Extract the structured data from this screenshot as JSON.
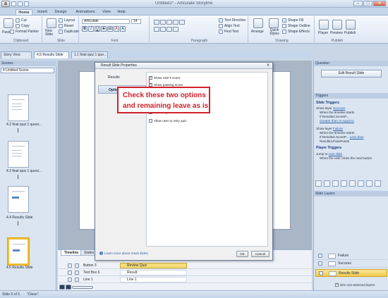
{
  "app": {
    "title": "Untitled1* - Articulate Storyline",
    "icon_letter": "a",
    "window_controls": [
      "–",
      "□",
      "✕"
    ]
  },
  "ribbon_tabs": [
    "Home",
    "Insert",
    "Design",
    "Animations",
    "View",
    "Help"
  ],
  "ribbon": {
    "clipboard": {
      "paste": "Paste",
      "cut": "Cut",
      "copy": "Copy",
      "format_painter": "Format Painter",
      "label": "Clipboard"
    },
    "slide": {
      "new_slide": "New Slide",
      "layout": "Layout",
      "reset": "Reset",
      "duplicate": "Duplicate",
      "label": "Slide"
    },
    "font": {
      "name": "Articulate",
      "size": "14",
      "label": "Font",
      "buttons": [
        "B",
        "I",
        "U",
        "S",
        "ab",
        "A",
        "A"
      ]
    },
    "paragraph": {
      "text_direction": "Text Direction",
      "align_text": "Align Text",
      "find_text": "Find Text",
      "label": "Paragraph"
    },
    "drawing": {
      "arrange": "Arrange",
      "quick_styles": "Quick Styles",
      "shape_fill": "Shape Fill",
      "shape_outline": "Shape Outline",
      "shape_effects": "Shape Effects",
      "label": "Drawing"
    },
    "publish": {
      "player": "Player",
      "preview": "Preview",
      "publish": "Publish",
      "label": "Publish"
    }
  },
  "doc_tabs": [
    "Story View",
    "4.5 Results Slide",
    "1.1 final quiz 1 que..."
  ],
  "scenes": {
    "header": "Scenes",
    "selected": "4 Untitled Scene",
    "slides": [
      {
        "label": "4.2 final quiz 1 quest..."
      },
      {
        "label": "4.3 final quiz 1 quest..."
      },
      {
        "label": "4.4 Results Slide"
      },
      {
        "label": "4.5 Results Slide"
      }
    ]
  },
  "dialog": {
    "title": "Result Slide Properties",
    "close": "✕",
    "nav": [
      {
        "label": "Results"
      },
      {
        "label": "Options"
      }
    ],
    "options": [
      {
        "label": "Show user's score",
        "checked": true
      },
      {
        "label": "Show passing score",
        "checked": true
      },
      {
        "label": "...hen reviewing",
        "checked": false
      },
      {
        "label": "...printing",
        "checked": false
      },
      {
        "label": "Allow user to retry quiz",
        "checked": false
      }
    ],
    "learn_more": "Learn more about result slides",
    "ok": "OK",
    "cancel": "Cancel"
  },
  "callout": {
    "line1": "Check these two options",
    "line2": "and remaining leave as is"
  },
  "timeline": {
    "tabs": [
      "Timeline",
      "States"
    ],
    "rows": [
      {
        "name": "Button 3",
        "bar": "Review Quiz"
      },
      {
        "name": "Text Box 6",
        "bar": "Result:"
      },
      {
        "name": "Line 1",
        "bar": "Line 1"
      }
    ]
  },
  "question": {
    "header": "Question",
    "edit_button": "Edit Result Slide"
  },
  "triggers": {
    "header": "Triggers",
    "slide_triggers": "Slide Triggers",
    "t1_show_layer": "Show layer",
    "t1_link": "Success",
    "t1_when": "When the timeline starts",
    "t1_if": "If Results4.ScoreP...",
    "t1_cond": "Greater than or equal to",
    "t2_show_layer": "Show layer",
    "t2_link": "Failure",
    "t2_when": "When the timeline starts",
    "t2_if": "If Results4.ScoreP...",
    "t2_cond": "Less than",
    "t2_var": "Results4.PassPoints",
    "player_triggers": "Player Triggers",
    "t3_jump": "Jump to",
    "t3_link": "next slide",
    "t3_when": "When the user clicks the next button"
  },
  "slide_layers": {
    "header": "Slide Layers",
    "layers": [
      "Failure",
      "Success",
      "Results Slide"
    ],
    "dim_label": "Dim non-selected layers"
  },
  "status": {
    "slide": "Slide 5 of 5",
    "theme": "\"Clean\""
  }
}
